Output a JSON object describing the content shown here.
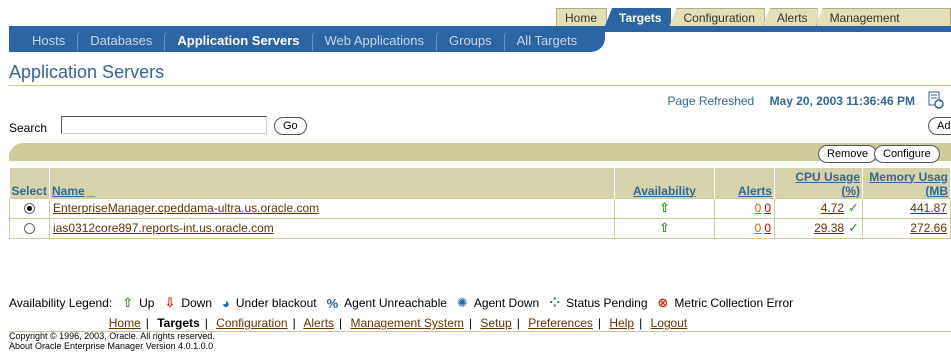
{
  "top_tabs": [
    "Home",
    "Targets",
    "Configuration",
    "Alerts",
    "Management System"
  ],
  "nav_items": [
    "Hosts",
    "Databases",
    "Application Servers",
    "Web Applications",
    "Groups",
    "All Targets"
  ],
  "page_title": "Application Servers",
  "refresh": {
    "label": "Page Refreshed",
    "timestamp": "May 20, 2003 11:36:46 PM"
  },
  "search": {
    "label": "Search",
    "value": "",
    "go_label": "Go"
  },
  "buttons": {
    "add": "Add",
    "remove": "Remove",
    "configure": "Configure"
  },
  "table": {
    "headers": {
      "select": "Select",
      "name": "Name",
      "availability": "Availability",
      "alerts": "Alerts",
      "cpu": "CPU Usage (%)",
      "memory": "Memory Usag",
      "memory_unit": "(MB"
    },
    "rows": [
      {
        "selected": true,
        "name": "EnterpriseManager.cpeddama-ultra.us.oracle.com",
        "alert_warn": "0",
        "alert_crit": "0",
        "cpu": "4.72",
        "memory": "441.87"
      },
      {
        "selected": false,
        "name": "ias0312core897.reports-int.us.oracle.com",
        "alert_warn": "0",
        "alert_crit": "0",
        "cpu": "29.38",
        "memory": "272.66"
      }
    ]
  },
  "legend": {
    "title": "Availability Legend:",
    "items": [
      "Up",
      "Down",
      "Under blackout",
      "Agent Unreachable",
      "Agent Down",
      "Status Pending",
      "Metric Collection Error"
    ]
  },
  "footer": {
    "links": [
      "Home",
      "Targets",
      "Configuration",
      "Alerts",
      "Management System",
      "Setup",
      "Preferences",
      "Help",
      "Logout"
    ],
    "copyright": "Copyright © 1996, 2003, Oracle. All rights reserved.",
    "about": "About Oracle Enterprise Manager Version 4.0.1.0.0"
  }
}
